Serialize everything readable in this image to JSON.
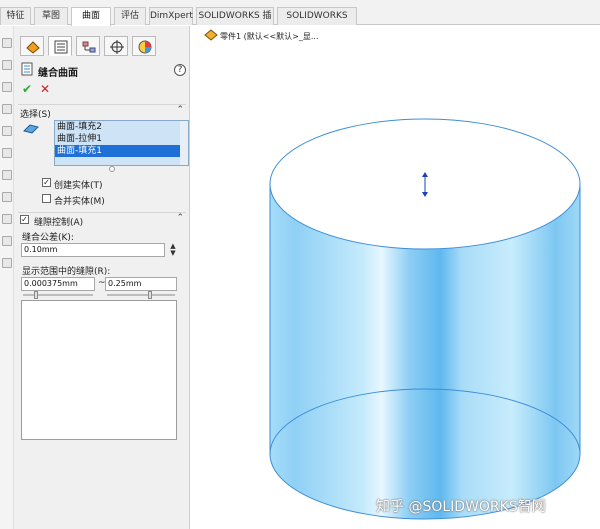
{
  "tabs": [
    "特征",
    "草图",
    "曲面",
    "评估",
    "DimXpert",
    "SOLIDWORKS 插件",
    "SOLIDWORKS MBD"
  ],
  "active_tab": "曲面",
  "property_manager": {
    "title": "缝合曲面",
    "help_symbol": "?",
    "ok_symbol": "✔",
    "cancel_symbol": "✕",
    "selections": {
      "header": "选择(S)",
      "items": [
        "曲面-填充2",
        "曲面-拉伸1",
        "曲面-填充1"
      ],
      "selected_index": 2,
      "create_solid": {
        "label": "创建实体(T)",
        "checked": true
      },
      "merge_entities": {
        "label": "合并实体(M)",
        "checked": false
      }
    },
    "gap_control": {
      "header": "缝隙控制(A)",
      "checked": true,
      "tolerance_label": "缝合公差(K):",
      "tolerance_value": "0.10mm",
      "range_label": "显示范围中的缝隙(R):",
      "range_min": "0.000375mm",
      "range_separator": "~",
      "range_max": "0.25mm"
    }
  },
  "graphics": {
    "tree_label": "零件1 (默认<<默认>_显..."
  },
  "watermark": "知乎 @SOLIDWORKS智网",
  "colors": {
    "accent_blue": "#1e6fd8",
    "selection_bg": "#cfe3f7",
    "cylinder_edge": "#3c8ed8",
    "cylinder_fill": "#8fd0f5",
    "ok_green": "#2ea72e",
    "cancel_red": "#d41c1c"
  },
  "icons": {
    "pm_tabs": [
      "feature-manager-icon",
      "property-manager-icon",
      "configuration-manager-icon",
      "dimxpert-manager-icon",
      "display-manager-icon"
    ],
    "title": "knit-surface-icon",
    "selection": "surface-selection-icon"
  }
}
